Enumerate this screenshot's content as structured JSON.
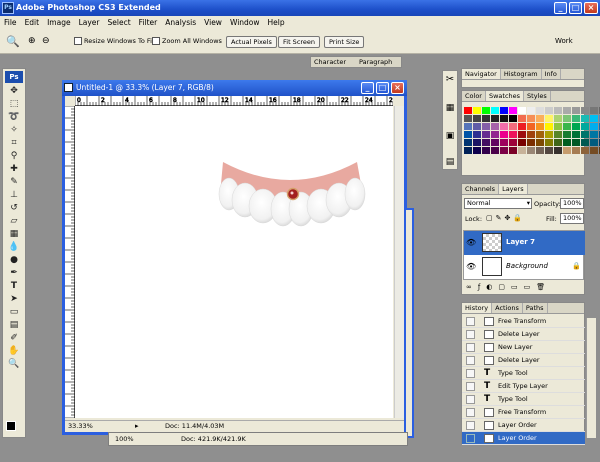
{
  "app": {
    "title": "Adobe Photoshop CS3 Extended",
    "logo": "Ps"
  },
  "menu": [
    "File",
    "Edit",
    "Image",
    "Layer",
    "Select",
    "Filter",
    "Analysis",
    "View",
    "Window",
    "Help"
  ],
  "options": {
    "resize_label": "Resize Windows To Fit",
    "zoom_all_label": "Zoom All Windows",
    "actual_pixels": "Actual Pixels",
    "fit_screen": "Fit Screen",
    "print_size": "Print Size",
    "workspace": "Work"
  },
  "panel_tabs": {
    "character": "Character",
    "paragraph": "Paragraph"
  },
  "document": {
    "title": "Untitled-1 @ 33.3% (Layer 7, RGB/8)",
    "ruler_marks": [
      "0",
      "2",
      "4",
      "6",
      "8",
      "10",
      "12",
      "14",
      "16",
      "18",
      "20",
      "22",
      "24",
      "26"
    ],
    "zoom": "33.33%",
    "doc_size": "Doc: 11.4M/4.03M"
  },
  "document2": {
    "zoom": "100%",
    "doc_size": "Doc: 421.9K/421.9K"
  },
  "navigator": {
    "tabs": [
      "Navigator",
      "Histogram",
      "Info"
    ]
  },
  "swatches": {
    "tabs": [
      "Color",
      "Swatches",
      "Styles"
    ]
  },
  "layers": {
    "tabs": [
      "Channels",
      "Layers"
    ],
    "blend_mode": "Normal",
    "opacity_label": "Opacity:",
    "opacity": "100%",
    "lock_label": "Lock:",
    "fill_label": "Fill:",
    "fill": "100%",
    "items": [
      {
        "name": "Layer 7",
        "selected": true
      },
      {
        "name": "Background",
        "selected": false
      }
    ]
  },
  "history": {
    "tabs": [
      "History",
      "Actions",
      "Paths"
    ],
    "items": [
      {
        "label": "Free Transform",
        "icon": "history-state-icon"
      },
      {
        "label": "Delete Layer",
        "icon": "history-state-icon"
      },
      {
        "label": "New Layer",
        "icon": "history-state-icon"
      },
      {
        "label": "Delete Layer",
        "icon": "history-state-icon"
      },
      {
        "label": "Type Tool",
        "icon": "type-icon"
      },
      {
        "label": "Edit Type Layer",
        "icon": "type-icon"
      },
      {
        "label": "Type Tool",
        "icon": "type-icon"
      },
      {
        "label": "Free Transform",
        "icon": "history-state-icon"
      },
      {
        "label": "Layer Order",
        "icon": "history-state-icon"
      },
      {
        "label": "Layer Order",
        "icon": "history-state-icon",
        "selected": true
      }
    ]
  },
  "colors": {
    "accent": "#2b5fe0",
    "selection": "#316ac5",
    "chrome": "#ece9d8"
  }
}
